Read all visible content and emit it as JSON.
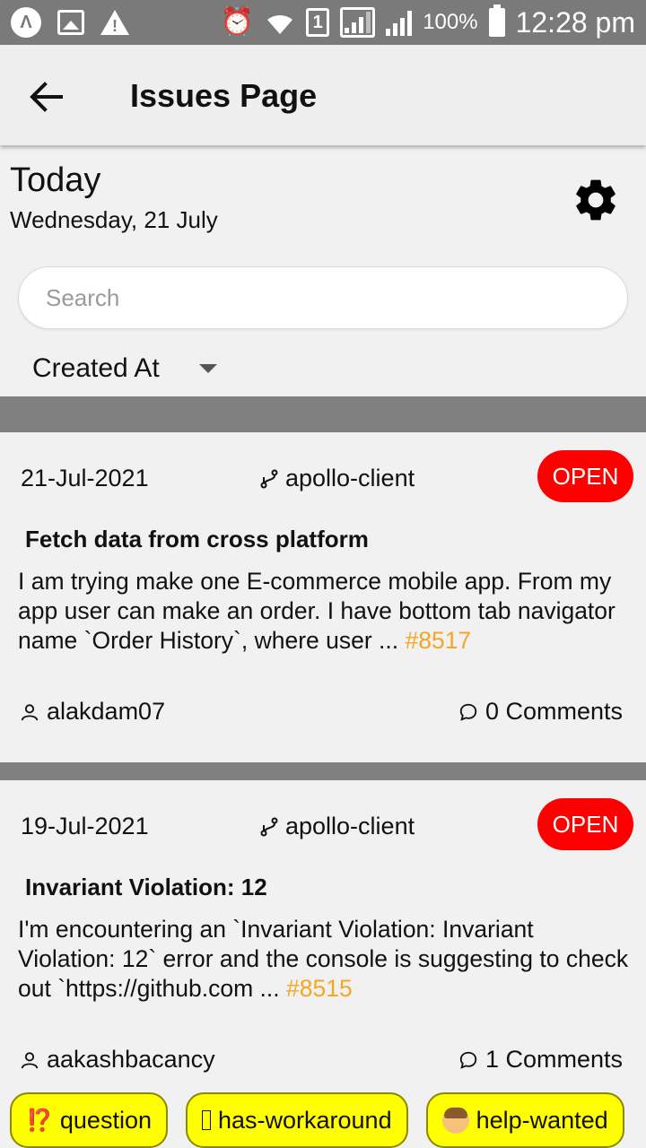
{
  "status_bar": {
    "battery": "100%",
    "time": "12:28 pm",
    "sim_slot": "1",
    "left_icons": [
      "app-a-icon",
      "image-icon",
      "warning-icon"
    ],
    "right_icons": [
      "alarm-icon",
      "wifi-icon",
      "sim-icon",
      "signal-icon",
      "signal-icon",
      "battery-icon"
    ]
  },
  "appbar": {
    "title": "Issues Page",
    "back_icon": "arrow-left-icon"
  },
  "header": {
    "today": "Today",
    "date": "Wednesday, 21 July",
    "settings_icon": "gear-icon"
  },
  "search": {
    "placeholder": "Search",
    "value": ""
  },
  "sort": {
    "selected": "Created At"
  },
  "issues": [
    {
      "date": "21-Jul-2021",
      "repo": "apollo-client",
      "status": "OPEN",
      "title": "Fetch data from cross platform",
      "body": " I am trying make one E-commerce mobile app. From my app user can make an order. I have bottom tab navigator name `Order History`, where user ... ",
      "number": "#8517",
      "author": "alakdam07",
      "comments": "0 Comments",
      "labels": []
    },
    {
      "date": "19-Jul-2021",
      "repo": "apollo-client",
      "status": "OPEN",
      "title": "Invariant Violation: 12",
      "body": " I'm encountering an `Invariant Violation: Invariant Violation: 12` error and the console is suggesting to check out `https://github.com ... ",
      "number": "#8515",
      "author": "aakashbacancy",
      "comments": "1 Comments",
      "labels": [
        {
          "emoji": "⁉️",
          "text": "question"
        },
        {
          "emoji": "",
          "text": "has-workaround"
        },
        {
          "emoji": "",
          "text": "help-wanted"
        }
      ]
    }
  ],
  "colors": {
    "status_bar": "#7a7a7a",
    "badge_open": "#ff0000",
    "issue_number": "#f5a623",
    "label_bg": "#ffff00",
    "separator": "#808080"
  }
}
